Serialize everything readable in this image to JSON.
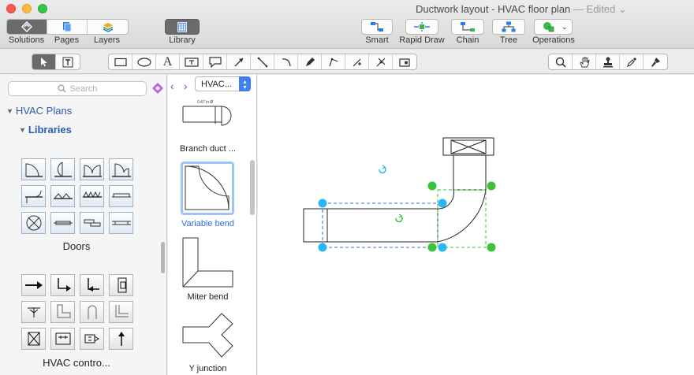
{
  "window": {
    "title": "Ductwork layout - HVAC floor plan",
    "status": "Edited"
  },
  "toolbar": {
    "view_tabs": [
      {
        "label": "Solutions",
        "icon": "solutions-icon",
        "active": true
      },
      {
        "label": "Pages",
        "icon": "pages-icon",
        "active": false
      },
      {
        "label": "Layers",
        "icon": "layers-icon",
        "active": false
      }
    ],
    "library_label": "Library",
    "actions": [
      {
        "label": "Smart",
        "icon": "smart-connector-icon"
      },
      {
        "label": "Rapid Draw",
        "icon": "rapid-draw-icon"
      },
      {
        "label": "Chain",
        "icon": "chain-icon"
      },
      {
        "label": "Tree",
        "icon": "tree-icon"
      },
      {
        "label": "Operations",
        "icon": "operations-icon"
      }
    ]
  },
  "tools": {
    "selection": [
      "pointer-tool-icon",
      "text-select-tool-icon"
    ],
    "drawing": [
      "rectangle-icon",
      "ellipse-icon",
      "text-icon",
      "text-box-icon",
      "callout-icon",
      "arrow-icon",
      "line-icon",
      "arc-icon",
      "pen-icon",
      "polyline-icon",
      "bezier-icon",
      "connector-icon",
      "insert-image-icon"
    ],
    "view": [
      "zoom-icon",
      "hand-icon",
      "stamp-icon",
      "eyedropper-icon",
      "format-brush-icon"
    ]
  },
  "sidebar": {
    "search_placeholder": "Search",
    "tree": {
      "root": "HVAC Plans",
      "child": "Libraries"
    },
    "libraries": [
      {
        "name": "Doors",
        "icon_count": 12
      },
      {
        "name": "HVAC contro...",
        "icon_count": 12
      }
    ]
  },
  "library_panel": {
    "selected_library": "HVAC...",
    "shapes": [
      {
        "label": "Branch duct ...",
        "caption": "0.47 in Ø",
        "selected": false
      },
      {
        "label": "Variable bend",
        "selected": true
      },
      {
        "label": "Miter bend",
        "selected": false
      },
      {
        "label": "Y junction",
        "selected": false
      }
    ]
  },
  "colors": {
    "accent": "#2a6ce0",
    "selection_handle": "#29b6f6",
    "secondary_handle": "#3cc13b",
    "active_tab": "#6b6b6b"
  }
}
